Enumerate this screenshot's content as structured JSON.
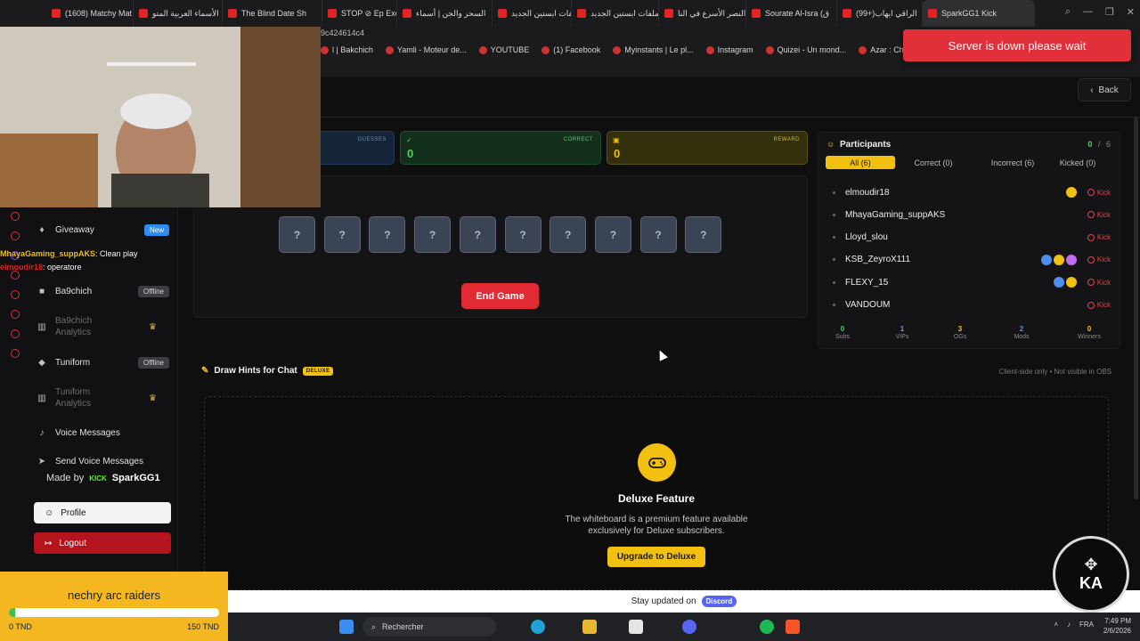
{
  "browser": {
    "tabs": [
      {
        "label": "(1608) Matchy Mat"
      },
      {
        "label": "الأسماء العربية المتو"
      },
      {
        "label": "The Blind Date Sh"
      },
      {
        "label": "STOP ⊘ Ep Excep"
      },
      {
        "label": "السحر والجن | أسماء"
      },
      {
        "label": "ملفات ابستين الجديد"
      },
      {
        "label": "ملفات ابستين الجديد"
      },
      {
        "label": "النصر الأسرع في النا"
      },
      {
        "label": "Sourate Al-Isra (ق"
      },
      {
        "label": "(99+)الراقي ايهاب"
      },
      {
        "label": "SparkGG1 Kick"
      }
    ],
    "url_fragment": "9c424614c4",
    "bookmarks": [
      "l | Bakchich",
      "Yamli - Moteur de...",
      "YOUTUBE",
      "(1) Facebook",
      "Myinstants | Le pl...",
      "Instagram",
      "Quizei - Un mond...",
      "Azar : Chat Vidéo..."
    ]
  },
  "toast": {
    "message": "Server is down please wait"
  },
  "back_label": "Back",
  "stats": {
    "guesses_label": "GUESSES",
    "correct_label": "CORRECT",
    "correct_value": "0",
    "reward_label": "REWARD",
    "reward_value": "0"
  },
  "game": {
    "tiles": [
      "?",
      "?",
      "?",
      "?",
      "?",
      "?",
      "?",
      "?",
      "?",
      "?"
    ],
    "end_game_label": "End Game"
  },
  "participants": {
    "title": "Participants",
    "count_correct": "0",
    "count_sep": "/",
    "count_total": "6",
    "tabs": [
      "All (6)",
      "Correct (0)",
      "Incorrect (6)",
      "Kicked (0)"
    ],
    "kick_label": "Kick",
    "rows": [
      {
        "name": "elmoudir18"
      },
      {
        "name": "MhayaGaming_suppAKS"
      },
      {
        "name": "Lloyd_slou"
      },
      {
        "name": "KSB_ZeyroX111"
      },
      {
        "name": "FLEXY_15"
      },
      {
        "name": "VANDOUM"
      }
    ],
    "stats": [
      {
        "value": "0",
        "label": "Subs",
        "color": "#53d05d"
      },
      {
        "value": "1",
        "label": "VIPs",
        "color": "#c26bf0"
      },
      {
        "value": "3",
        "label": "OGs",
        "color": "#f2c010"
      },
      {
        "value": "2",
        "label": "Mods",
        "color": "#4d8ff0"
      },
      {
        "value": "0",
        "label": "Winners",
        "color": "#f2c010"
      }
    ]
  },
  "hints": {
    "title": "Draw Hints for Chat",
    "tag": "DELUXE",
    "note": "Client-side only • Not visible in OBS",
    "feature_title": "Deluxe Feature",
    "feature_desc": "The whiteboard is a premium feature available exclusively for Deluxe subscribers.",
    "upgrade_label": "Upgrade to Deluxe"
  },
  "sidebar": {
    "items": [
      {
        "label": "Giveaway",
        "badge": "New"
      },
      {
        "label": "Ba9chich",
        "badge": "Offline"
      },
      {
        "label": "Ba9chich Analytics"
      },
      {
        "label": "Tuniform",
        "badge": "Offline"
      },
      {
        "label": "Tuniform Analytics"
      },
      {
        "label": "Voice Messages"
      },
      {
        "label": "Send Voice Messages"
      }
    ],
    "made_by_prefix": "Made by",
    "made_by_kick": "KICK",
    "made_by_name": "SparkGG1",
    "profile_label": "Profile",
    "logout_label": "Logout"
  },
  "overlay_chat": [
    {
      "user": "MhayaGaming_suppAKS",
      "text": ": Clean play"
    },
    {
      "user": "elmoudir18",
      "text": ": operatore"
    }
  ],
  "goal": {
    "title": "nechry arc raiders",
    "min_label": "0 TND",
    "max_label": "150 TND",
    "progress": 0.03
  },
  "footer": {
    "text": "Stay updated on",
    "pill": "Discord"
  },
  "taskbar": {
    "search_placeholder": "Rechercher",
    "lang": "FRA",
    "time": "7:49 PM",
    "date": "2/6/2026"
  },
  "logo": {
    "text": "KA"
  }
}
